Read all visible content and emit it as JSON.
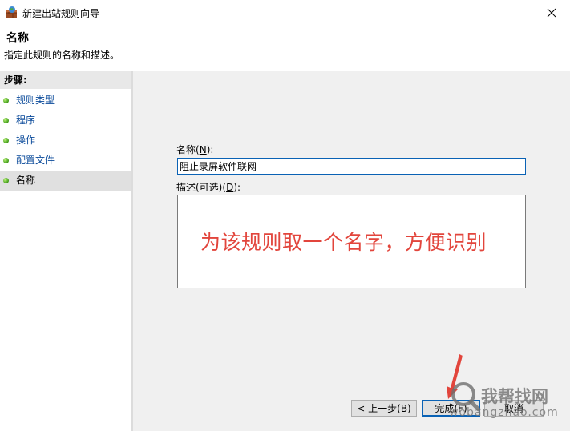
{
  "window": {
    "title": "新建出站规则向导",
    "icon": "firewall-app-icon",
    "close_icon": "close-icon"
  },
  "header": {
    "title": "名称",
    "subtitle": "指定此规则的名称和描述。"
  },
  "steps": {
    "title": "步骤:",
    "items": [
      {
        "label": "规则类型",
        "active": false
      },
      {
        "label": "程序",
        "active": false
      },
      {
        "label": "操作",
        "active": false
      },
      {
        "label": "配置文件",
        "active": false
      },
      {
        "label": "名称",
        "active": true
      }
    ]
  },
  "form": {
    "name_label": "名称",
    "name_label_key": "N",
    "name_value": "阻止录屏软件联网",
    "desc_label": "描述(可选)",
    "desc_label_key": "D",
    "desc_value": ""
  },
  "annotation": {
    "text": "为该规则取一个名字，方便识别",
    "color": "#e2453c"
  },
  "buttons": {
    "back": "< 上一步",
    "back_key": "B",
    "finish": "完成",
    "finish_key": "F",
    "cancel": "取消"
  },
  "watermark": {
    "text": "我帮找网",
    "url": "wobangzhao.com"
  }
}
